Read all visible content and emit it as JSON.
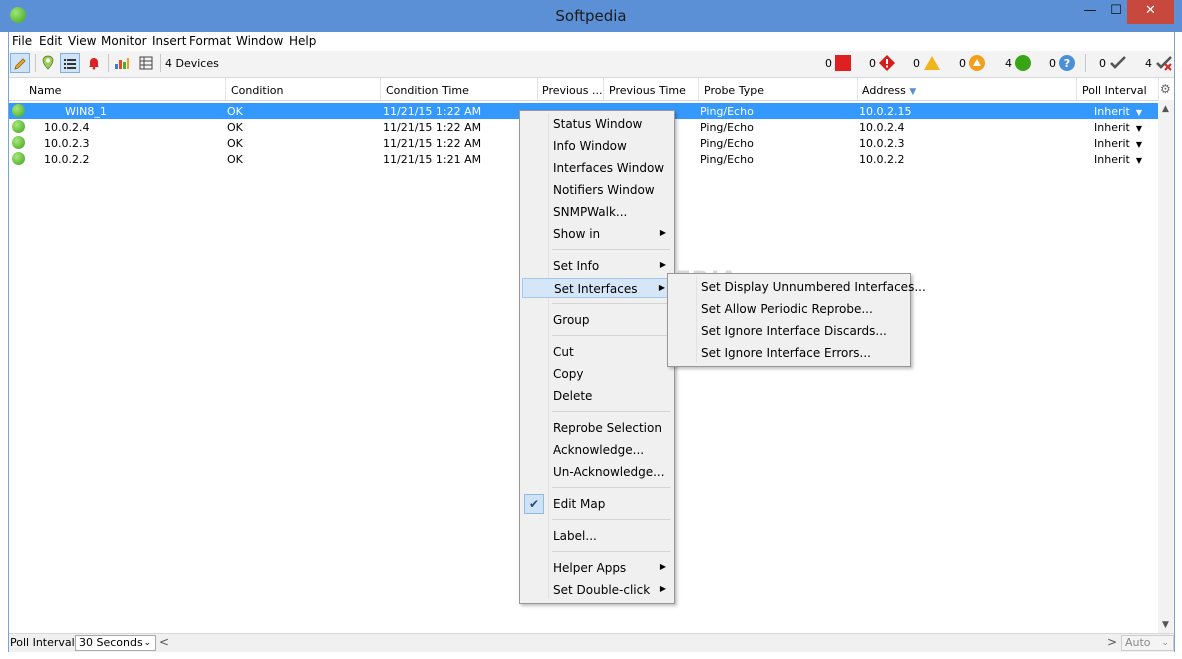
{
  "window": {
    "title": "Softpedia",
    "minimize": "—",
    "maximize": "☐",
    "close": "✕"
  },
  "menubar": [
    "File",
    "Edit",
    "View",
    "Monitor",
    "Insert",
    "Format",
    "Window",
    "Help"
  ],
  "toolbar": {
    "devices_label": "4 Devices",
    "status_counts": [
      {
        "count": "0",
        "icon": "red-square-icon",
        "color": "#e02020"
      },
      {
        "count": "0",
        "icon": "red-diamond-alert-icon",
        "color": "#d41c1c"
      },
      {
        "count": "0",
        "icon": "yellow-triangle-icon",
        "color": "#f1b51c"
      },
      {
        "count": "0",
        "icon": "orange-circle-alert-icon",
        "color": "#f2a01c"
      },
      {
        "count": "4",
        "icon": "green-circle-icon",
        "color": "#3aa417"
      },
      {
        "count": "0",
        "icon": "blue-question-icon",
        "color": "#4a90d9"
      },
      {
        "count": "0",
        "icon": "checkmark-icon",
        "color": "#555555"
      },
      {
        "count": "4",
        "icon": "checkmark-red-icon",
        "color": "#555555"
      }
    ]
  },
  "table": {
    "columns": [
      "Name",
      "Condition",
      "Condition Time",
      "Previous ...",
      "Previous Time",
      "Probe Type",
      "Address",
      "Poll Interval"
    ],
    "rows": [
      {
        "name": "WIN8_1",
        "condition": "OK",
        "condition_time": "11/21/15 1:22 AM",
        "probe": "Ping/Echo",
        "address": "10.0.2.15",
        "poll": "Inherit"
      },
      {
        "name": "10.0.2.4",
        "condition": "OK",
        "condition_time": "11/21/15 1:22 AM",
        "probe": "Ping/Echo",
        "address": "10.0.2.4",
        "poll": "Inherit"
      },
      {
        "name": "10.0.2.3",
        "condition": "OK",
        "condition_time": "11/21/15 1:22 AM",
        "probe": "Ping/Echo",
        "address": "10.0.2.3",
        "poll": "Inherit"
      },
      {
        "name": "10.0.2.2",
        "condition": "OK",
        "condition_time": "11/21/15 1:21 AM",
        "probe": "Ping/Echo",
        "address": "10.0.2.2",
        "poll": "Inherit"
      }
    ]
  },
  "context_menu": {
    "items": [
      "Status Window",
      "Info Window",
      "Interfaces Window",
      "Notifiers Window",
      "SNMPWalk...",
      "Show in",
      "Set Info",
      "Set Interfaces",
      "Group",
      "Cut",
      "Copy",
      "Delete",
      "Reprobe Selection",
      "Acknowledge...",
      "Un-Acknowledge...",
      "Edit Map",
      "Label...",
      "Helper Apps",
      "Set Double-click"
    ]
  },
  "submenu": {
    "items": [
      "Set Display Unnumbered Interfaces...",
      "Set Allow Periodic Reprobe...",
      "Set Ignore Interface Discards...",
      "Set Ignore Interface Errors..."
    ]
  },
  "statusbar": {
    "poll_label": "Poll Interval:",
    "poll_value": "30 Seconds",
    "auto_value": "Auto"
  },
  "watermark": "SOFTPEDIA"
}
